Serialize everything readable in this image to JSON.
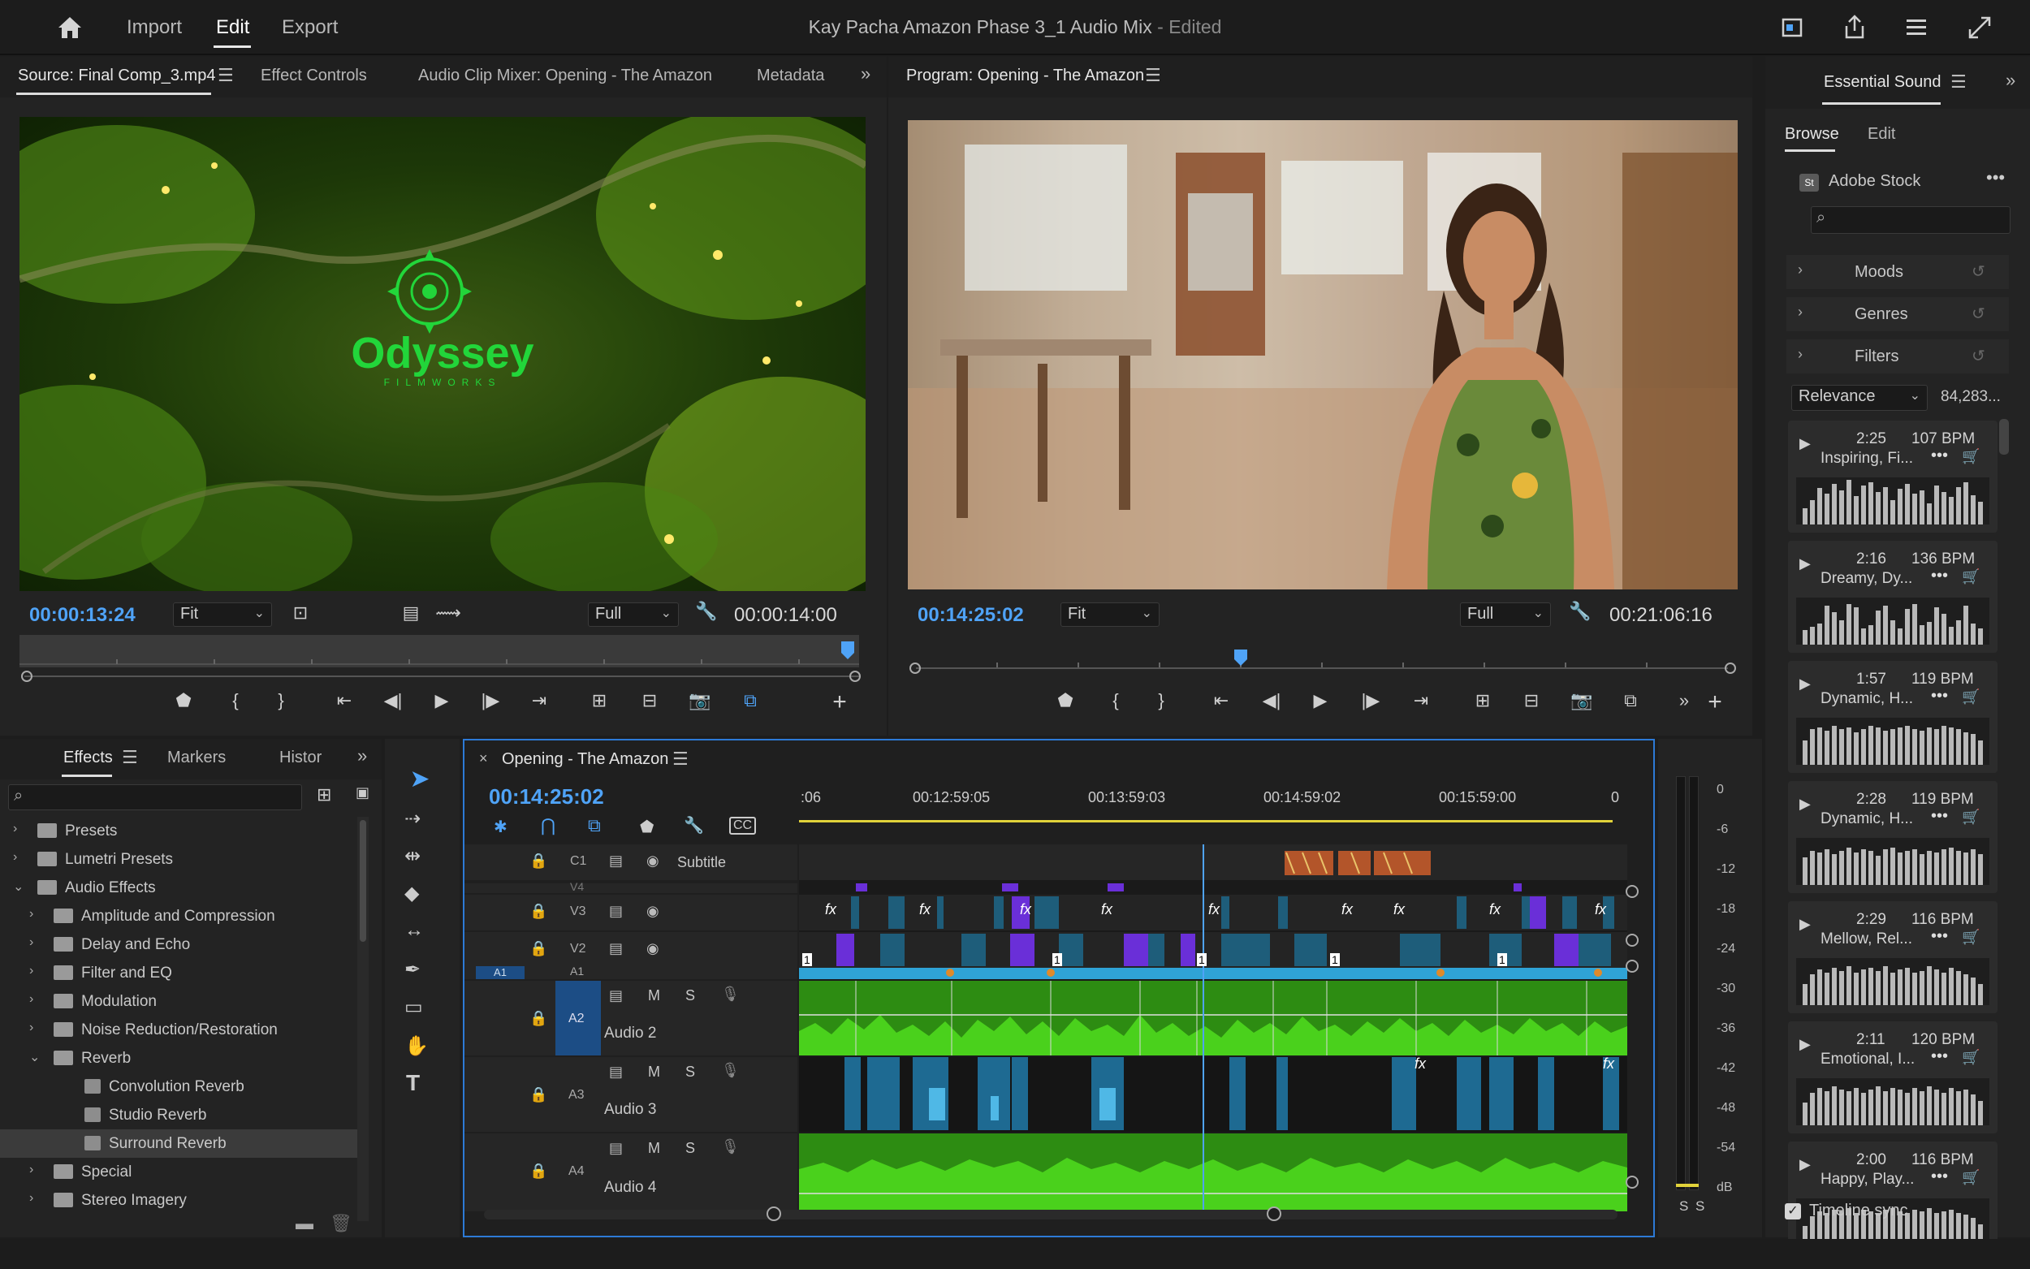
{
  "topbar": {
    "nav": [
      "Import",
      "Edit",
      "Export"
    ],
    "active": "Edit",
    "title": "Kay Pacha Amazon Phase 3_1 Audio Mix",
    "status": "- Edited"
  },
  "source_panel": {
    "tabs": [
      "Source: Final Comp_3.mp4",
      "Effect Controls",
      "Audio Clip Mixer: Opening - The Amazon",
      "Metadata"
    ],
    "logo_text": "Odyssey",
    "logo_sub": "FILMWORKS",
    "timecode_current": "00:00:13:24",
    "zoom": "Fit",
    "quality": "Full",
    "timecode_duration": "00:00:14:00"
  },
  "program_panel": {
    "title": "Program: Opening - The Amazon",
    "timecode_current": "00:14:25:02",
    "zoom": "Fit",
    "quality": "Full",
    "timecode_duration": "00:21:06:16"
  },
  "effects_panel": {
    "tabs": [
      "Effects",
      "Markers",
      "Histor"
    ],
    "tree": [
      {
        "label": "Presets",
        "type": "folder",
        "level": 0,
        "expanded": false
      },
      {
        "label": "Lumetri Presets",
        "type": "folder",
        "level": 0,
        "expanded": false
      },
      {
        "label": "Audio Effects",
        "type": "folder",
        "level": 0,
        "expanded": true
      },
      {
        "label": "Amplitude and Compression",
        "type": "folder",
        "level": 1,
        "expanded": false
      },
      {
        "label": "Delay and Echo",
        "type": "folder",
        "level": 1,
        "expanded": false
      },
      {
        "label": "Filter and EQ",
        "type": "folder",
        "level": 1,
        "expanded": false
      },
      {
        "label": "Modulation",
        "type": "folder",
        "level": 1,
        "expanded": false
      },
      {
        "label": "Noise Reduction/Restoration",
        "type": "folder",
        "level": 1,
        "expanded": false
      },
      {
        "label": "Reverb",
        "type": "folder",
        "level": 1,
        "expanded": true
      },
      {
        "label": "Convolution Reverb",
        "type": "effect",
        "level": 2
      },
      {
        "label": "Studio Reverb",
        "type": "effect",
        "level": 2
      },
      {
        "label": "Surround Reverb",
        "type": "effect",
        "level": 2,
        "selected": true
      },
      {
        "label": "Special",
        "type": "folder",
        "level": 1,
        "expanded": false
      },
      {
        "label": "Stereo Imagery",
        "type": "folder",
        "level": 1,
        "expanded": false
      }
    ]
  },
  "timeline": {
    "tab": "Opening - The Amazon",
    "timecode": "00:14:25:02",
    "ruler": [
      ":06",
      "00:12:59:05",
      "00:13:59:03",
      "00:14:59:02",
      "00:15:59:00",
      "0"
    ],
    "tracks": {
      "c1": {
        "id": "C1",
        "name": "Subtitle"
      },
      "v4": {
        "id": "V4"
      },
      "v3": {
        "id": "V3"
      },
      "v2": {
        "id": "V2"
      },
      "a1": {
        "id": "A1",
        "src": "A1"
      },
      "a2": {
        "id": "A2",
        "name": "Audio 2"
      },
      "a3": {
        "id": "A3",
        "name": "Audio 3"
      },
      "a4": {
        "id": "A4",
        "name": "Audio 4"
      }
    },
    "track_buttons": {
      "mute": "M",
      "solo": "S"
    },
    "clip_fx_label": "fx",
    "clip_badge": "1"
  },
  "meter": {
    "scale": [
      "0",
      "-6",
      "-12",
      "-18",
      "-24",
      "-30",
      "-36",
      "-42",
      "-48",
      "-54",
      "dB"
    ],
    "solo_labels": [
      "S",
      "S"
    ]
  },
  "essential_sound": {
    "title": "Essential Sound",
    "tabs": [
      "Browse",
      "Edit"
    ],
    "stock_badge": "St",
    "stock_label": "Adobe Stock",
    "filters": [
      "Moods",
      "Genres",
      "Filters"
    ],
    "sort": "Relevance",
    "count": "84,283...",
    "tracks": [
      {
        "duration": "2:25",
        "bpm": "107 BPM",
        "mood": "Inspiring, Fi..."
      },
      {
        "duration": "2:16",
        "bpm": "136 BPM",
        "mood": "Dreamy, Dy..."
      },
      {
        "duration": "1:57",
        "bpm": "119 BPM",
        "mood": "Dynamic, H..."
      },
      {
        "duration": "2:28",
        "bpm": "119 BPM",
        "mood": "Dynamic, H..."
      },
      {
        "duration": "2:29",
        "bpm": "116 BPM",
        "mood": "Mellow, Rel..."
      },
      {
        "duration": "2:11",
        "bpm": "120 BPM",
        "mood": "Emotional, I..."
      },
      {
        "duration": "2:00",
        "bpm": "116 BPM",
        "mood": "Happy, Play..."
      }
    ],
    "timeline_sync": "Timeline sync"
  },
  "colors": {
    "accent_blue": "#4fa3f7",
    "audio_green": "#3fbf1d",
    "audio_blue": "#2fa3d6",
    "video_purple": "#6a2fd8",
    "subtitle_orange": "#b3552a"
  }
}
